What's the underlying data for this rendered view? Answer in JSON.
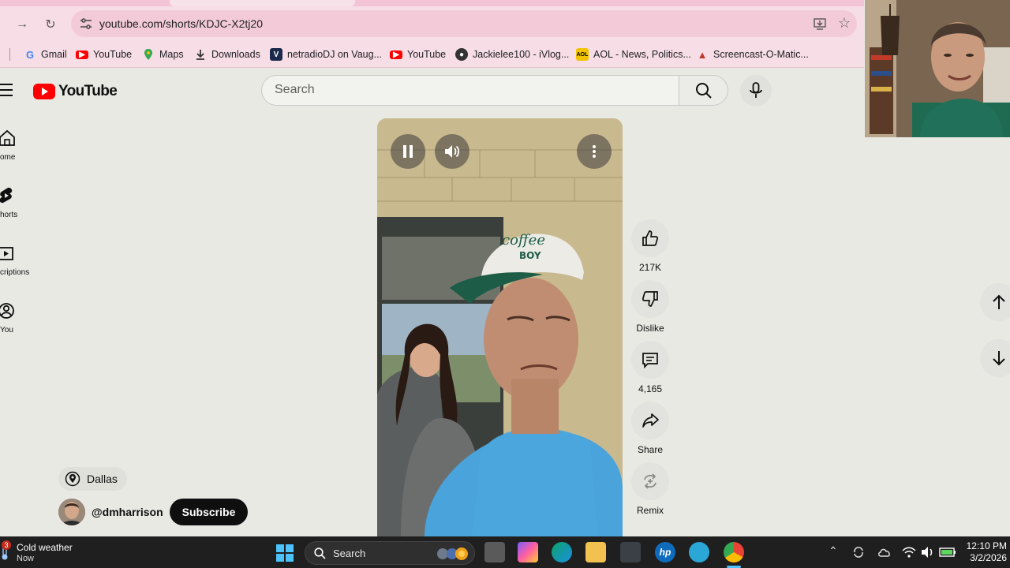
{
  "browser": {
    "url": "youtube.com/shorts/KDJC-X2tj20",
    "bookmarks": [
      {
        "label": "Gmail",
        "icon": "google-icon",
        "color": "#ffffff"
      },
      {
        "label": "YouTube",
        "icon": "youtube-icon",
        "color": "#ff0000"
      },
      {
        "label": "Maps",
        "icon": "maps-pin-icon",
        "color": "#34a853"
      },
      {
        "label": "Downloads",
        "icon": "download-icon",
        "color": "#333333"
      },
      {
        "label": "netradioDJ on Vaug...",
        "icon": "vaughn-icon",
        "color": "#1b2a4a"
      },
      {
        "label": "YouTube",
        "icon": "youtube-icon",
        "color": "#ff0000"
      },
      {
        "label": "Jackielee100 - iVlog...",
        "icon": "ivlog-icon",
        "color": "#333333"
      },
      {
        "label": "AOL - News, Politics...",
        "icon": "aol-icon",
        "color": "#f2c400"
      },
      {
        "label": "Screencast-O-Matic...",
        "icon": "screencast-icon",
        "color": "#c0392b"
      }
    ]
  },
  "youtube": {
    "logo_text": "YouTube",
    "search_placeholder": "Search",
    "nav": [
      {
        "label": "ome",
        "icon": "home-icon"
      },
      {
        "label": "horts",
        "icon": "shorts-icon"
      },
      {
        "label": "criptions",
        "icon": "subscriptions-icon"
      },
      {
        "label": "You",
        "icon": "you-icon"
      }
    ]
  },
  "short": {
    "actions": [
      {
        "label": "217K",
        "icon": "thumbs-up-icon"
      },
      {
        "label": "Dislike",
        "icon": "thumbs-down-icon"
      },
      {
        "label": "4,165",
        "icon": "comment-icon"
      },
      {
        "label": "Share",
        "icon": "share-icon"
      },
      {
        "label": "Remix",
        "icon": "remix-icon"
      }
    ],
    "location": "Dallas",
    "channel_handle": "@dmharrison",
    "subscribe_label": "Subscribe"
  },
  "taskbar": {
    "weather_badge": "3",
    "weather_title": "Cold weather",
    "weather_sub": "Now",
    "search_placeholder": "Search",
    "time": "12:10 PM",
    "date": "3/2/2026"
  },
  "colors": {
    "accent_red": "#ff0000",
    "chrome_pink": "#f7dde6",
    "page_bg": "#e9e9e4",
    "taskbar_bg": "#1f1f1f"
  }
}
